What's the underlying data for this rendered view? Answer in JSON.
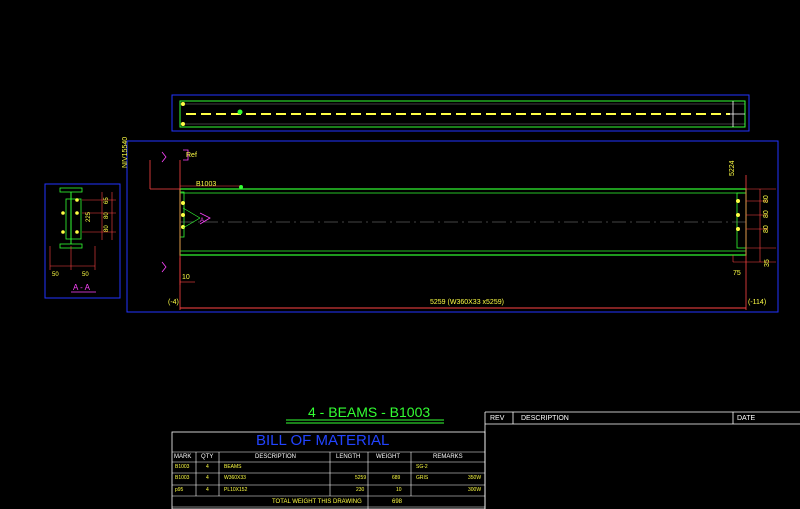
{
  "drawing": {
    "title": "4 - BEAMS - B1003",
    "beam_label": "B1003",
    "ref_label": "Ref",
    "elev_label": "NIV15540",
    "top_right_dim": "5224",
    "section_label": "A - A",
    "section_marker": "A",
    "overall_dim": "5259 (W360X33 x5259)",
    "left_paren": "(-4)",
    "right_paren": "(-114)",
    "left_dim_10": "10",
    "right_dim_75": "75",
    "right_dim_35": "35",
    "right_dims": [
      "80",
      "80",
      "80"
    ],
    "section_dims_side": [
      "65",
      "80",
      "80"
    ],
    "section_dim_total": "225",
    "section_bottom_dims": [
      "50",
      "50"
    ]
  },
  "revision_table": {
    "headers": {
      "rev": "REV",
      "description": "DESCRIPTION",
      "date": "DATE"
    }
  },
  "bom": {
    "title": "BILL OF MATERIAL",
    "headers": {
      "mark": "MARK",
      "qty": "QTY",
      "description": "DESCRIPTION",
      "length": "LENGTH",
      "weight": "WEIGHT",
      "remarks": "REMARKS"
    },
    "rows": [
      {
        "mark": "B1003",
        "qty": "4",
        "description": "BEAMS",
        "length": "",
        "weight": "",
        "remarks": "SG-2",
        "remarks2": ""
      },
      {
        "mark": "B1003",
        "qty": "4",
        "description": "W360X33",
        "length": "5259",
        "weight": "689",
        "remarks": "GRIS",
        "remarks2": "350W"
      },
      {
        "mark": "p95",
        "qty": "4",
        "description": "PL10X152",
        "length": "230",
        "weight": "10",
        "remarks": "",
        "remarks2": "300W"
      }
    ],
    "total_label": "TOTAL WEIGHT THIS DRAWING",
    "total_value": "698"
  },
  "colors": {
    "outline_blue": "#2233ff",
    "beam_green": "#33ff33",
    "dim_red": "#ff4444",
    "marker_magenta": "#ff44ff",
    "text_yellow": "#ffff44"
  }
}
